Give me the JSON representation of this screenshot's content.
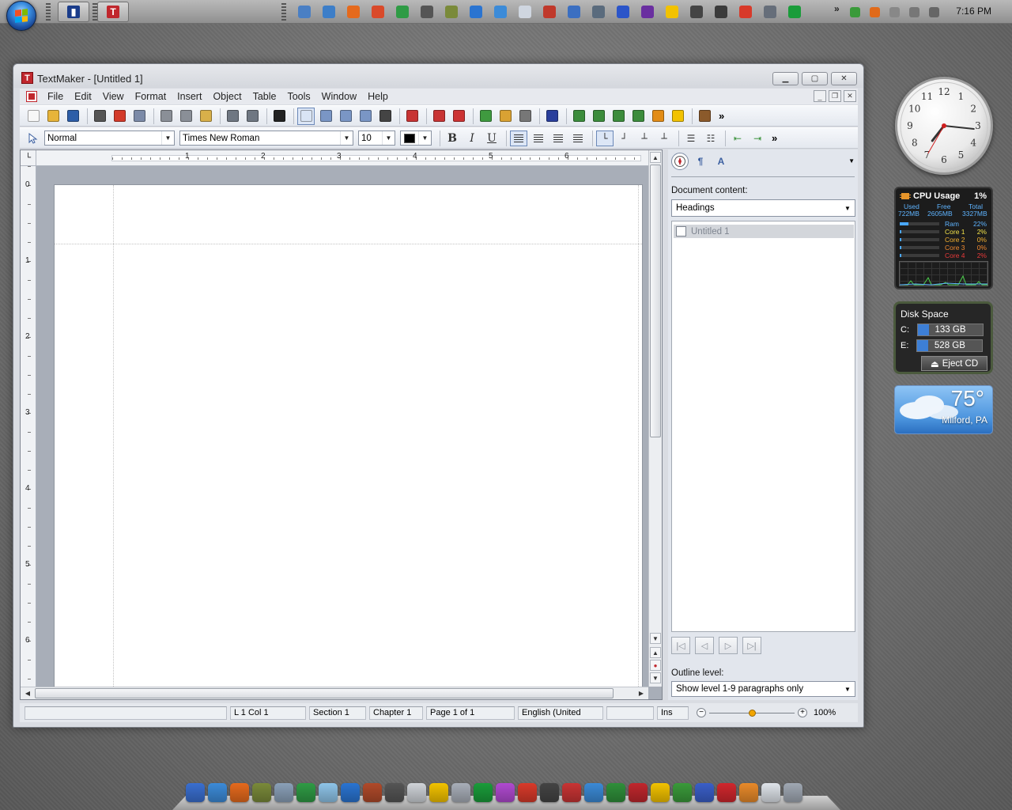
{
  "taskbar": {
    "time": "7:16 PM",
    "pinned_colors": [
      "#1a3c8a",
      "#c0272d"
    ],
    "pinned_letters": [
      "",
      "T"
    ],
    "tray_colors": [
      "#4a7fc4",
      "#3d7ec8",
      "#e56a1d",
      "#d94a2a",
      "#2f9b45",
      "#555555",
      "#7a8a3a",
      "#2a74d1",
      "#3c8bd8",
      "#cfd6e0",
      "#c0392b",
      "#3b6fc1",
      "#5a6b7d",
      "#2b55c9",
      "#6a2fa0",
      "#f2c200",
      "#444444",
      "#3b3b3b",
      "#d83a2a",
      "#666e7a",
      "#1a9c3a"
    ],
    "notify_colors": [
      "#3a9a3a",
      "#e06a1a",
      "#888888",
      "#777777",
      "#666666"
    ]
  },
  "window": {
    "title": "TextMaker - [Untitled 1]",
    "app_icon_letter": "T",
    "menu": [
      "File",
      "Edit",
      "View",
      "Format",
      "Insert",
      "Object",
      "Table",
      "Tools",
      "Window",
      "Help"
    ],
    "toolbar1_icon_colors": [
      "#f7f7f7",
      "#e7b43a",
      "#2d5ea8",
      "#555555",
      "#d33a2a",
      "#7b8aa8",
      "#8a8f97",
      "#8a8f97",
      "#d8b04a",
      "#6f7782",
      "#6f7782",
      "#222222",
      "#d9e4f4",
      "#7a96c5",
      "#7a96c5",
      "#7a96c5",
      "#444444",
      "#c83434",
      "#c83434",
      "#cc3333",
      "#3f9a3f",
      "#d9a233",
      "#777777",
      "#2a3f9c",
      "#3c8c3c",
      "#3c8c3c",
      "#3c8c3c",
      "#3c8c3c",
      "#e28c17",
      "#f2c200",
      "#8b5a2b"
    ],
    "style_value": "Normal",
    "font_value": "Times New Roman",
    "size_value": "10",
    "color_value": "#000000"
  },
  "ruler": {
    "h_numbers": [
      "1",
      "2",
      "3",
      "4",
      "5",
      "6"
    ],
    "v_numbers": [
      "0",
      "1",
      "2",
      "3",
      "4",
      "5",
      "6"
    ]
  },
  "sidebar": {
    "content_label": "Document content:",
    "content_value": "Headings",
    "items": [
      {
        "label": "Untitled 1",
        "checked": false
      }
    ],
    "outline_label": "Outline level:",
    "outline_value": "Show level 1-9 paragraphs only"
  },
  "status": {
    "position": "L 1 Col 1",
    "section": "Section 1",
    "chapter": "Chapter 1",
    "page": "Page 1 of 1",
    "language": "English (United",
    "mode": "Ins",
    "zoom": "100%",
    "zoom_fraction": 0.5
  },
  "gadgets": {
    "cpu": {
      "title": "CPU Usage",
      "percent": "1%",
      "used_label": "Used",
      "used": "722MB",
      "free_label": "Free",
      "free": "2605MB",
      "total_label": "Total",
      "total": "3327MB",
      "rows": [
        {
          "name": "Ram",
          "value": "22%",
          "color": "#5fb4ff",
          "fraction": 0.22
        },
        {
          "name": "Core 1",
          "value": "2%",
          "color": "#f2e24a",
          "fraction": 0.02
        },
        {
          "name": "Core 2",
          "value": "0%",
          "color": "#f2b030",
          "fraction": 0.0
        },
        {
          "name": "Core 3",
          "value": "0%",
          "color": "#f08a30",
          "fraction": 0.0
        },
        {
          "name": "Core 4",
          "value": "2%",
          "color": "#e83a3a",
          "fraction": 0.02
        }
      ]
    },
    "disk": {
      "title": "Disk Space",
      "drives": [
        {
          "letter": "C:",
          "size": "133 GB"
        },
        {
          "letter": "E:",
          "size": "528 GB"
        }
      ],
      "eject_label": "Eject CD"
    },
    "weather": {
      "temp": "75°",
      "city": "Milford, PA"
    },
    "clock_numbers": [
      "12",
      "1",
      "2",
      "3",
      "4",
      "5",
      "6",
      "7",
      "8",
      "9",
      "10",
      "11"
    ]
  },
  "dock": {
    "icon_colors": [
      "#3a6fd0",
      "#3c8bd8",
      "#e56a1d",
      "#7a8a3a",
      "#8aa0b8",
      "#2f9b45",
      "#8ec4e8",
      "#2a74d1",
      "#b04a2a",
      "#555555",
      "#cfd3d8",
      "#f2c200",
      "#a8aeb8",
      "#1a9c3a",
      "#b04ad0",
      "#d83a2a",
      "#444444",
      "#c83434",
      "#3b8ad6",
      "#2f8f3a",
      "#c0272d",
      "#f2c200",
      "#3a9a3a",
      "#3a5fc8",
      "#d0272d",
      "#e88a2a",
      "#dfe4ea",
      "#a0a8b3"
    ]
  }
}
